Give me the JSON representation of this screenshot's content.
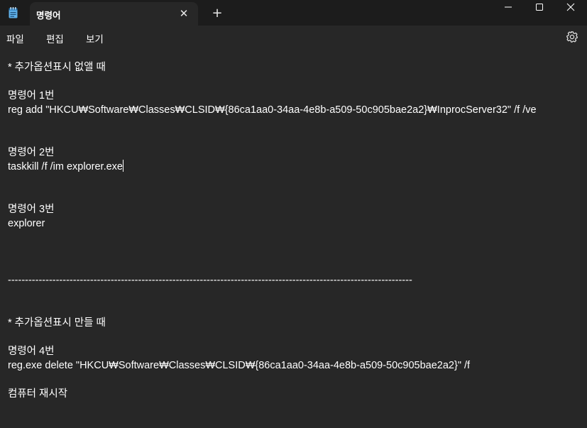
{
  "window": {
    "tab_title": "명령어",
    "tab_close": "✕",
    "new_tab": "+",
    "icons": {
      "app": "notepad-icon",
      "minimize": "minimize-icon",
      "maximize": "maximize-icon",
      "close": "close-icon"
    }
  },
  "menu": {
    "file": "파일",
    "edit": "편집",
    "view": "보기",
    "settings_icon": "gear-icon"
  },
  "document": {
    "lines": [
      "* 추가옵션표시 없앨 때",
      "명령어 1번",
      "reg add \"HKCU₩Software₩Classes₩CLSID₩{86ca1aa0-34aa-4e8b-a509-50c905bae2a2}₩InprocServer32\" /f /ve",
      "명령어 2번",
      "taskkill /f /im explorer.exe",
      "명령어 3번",
      "explorer",
      "----------------------------------------------------------------------------------------------------------------------",
      "* 추가옵션표시 만들 때",
      "명령어 4번",
      "reg.exe delete \"HKCU₩Software₩Classes₩CLSID₩{86ca1aa0-34aa-4e8b-a509-50c905bae2a2}\" /f",
      "컴퓨터 재시작"
    ]
  }
}
